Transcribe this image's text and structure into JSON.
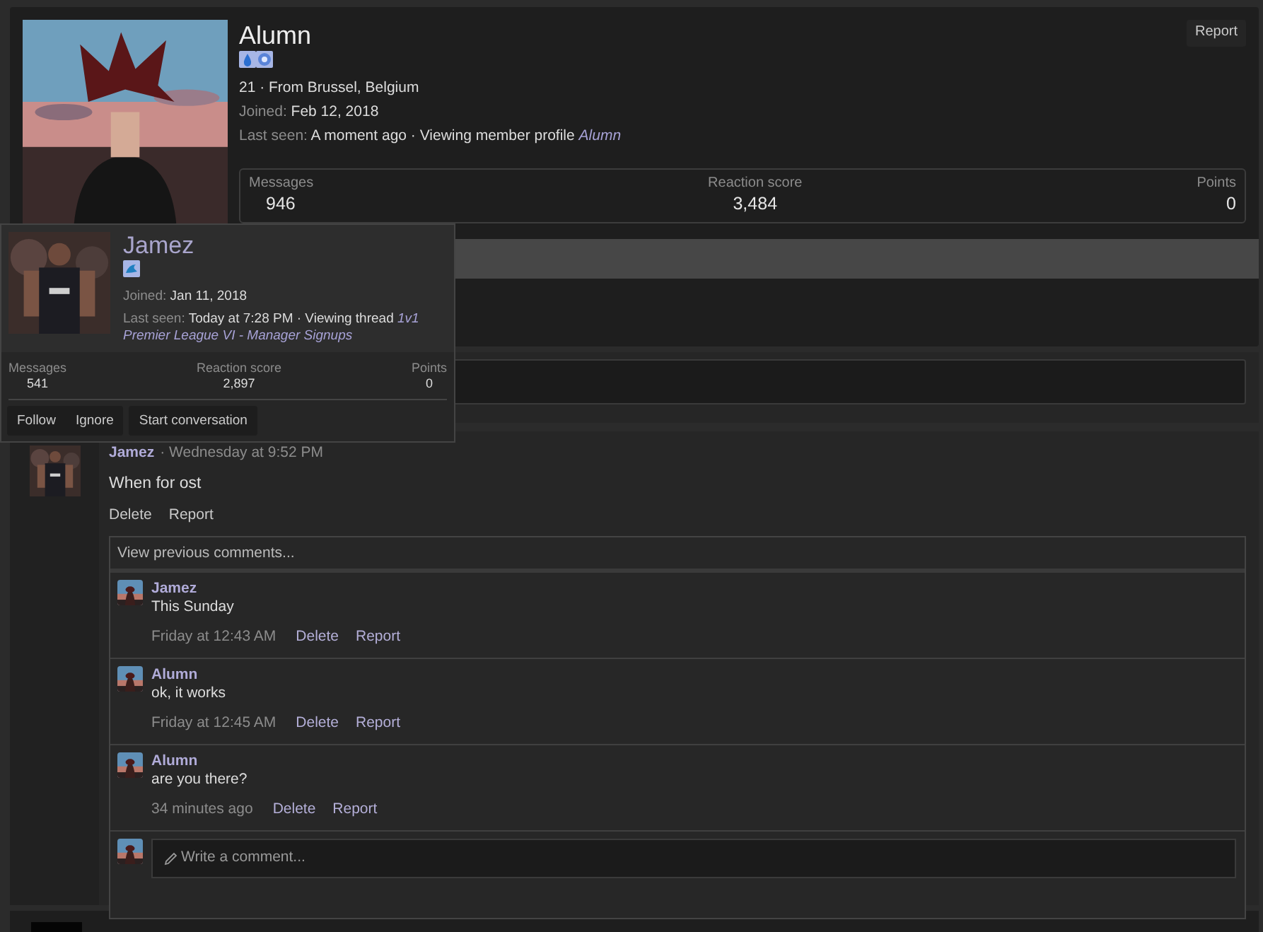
{
  "profile": {
    "name": "Alumn",
    "report": "Report",
    "about": "21 · From Brussel, Belgium",
    "joined": {
      "label": "Joined:",
      "value": "Feb 12, 2018"
    },
    "last_seen": {
      "label": "Last seen:",
      "value": "A moment ago · Viewing member profile",
      "link": "Alumn"
    },
    "stats": [
      {
        "label": "Messages",
        "value": "946"
      },
      {
        "label": "Reaction score",
        "value": "3,484"
      },
      {
        "label": "Points",
        "value": "0"
      }
    ]
  },
  "status_field": {
    "kind": "empty"
  },
  "popup": {
    "name": "Jamez",
    "joined": {
      "label": "Joined:",
      "value": "Jan 11, 2018"
    },
    "last_seen": {
      "label": "Last seen:",
      "value": "Today at 7:28 PM · Viewing thread",
      "link": "1v1 Premier League VI - Manager Signups"
    },
    "stats": [
      {
        "label": "Messages",
        "value": "541"
      },
      {
        "label": "Reaction score",
        "value": "2,897"
      },
      {
        "label": "Points",
        "value": "0"
      }
    ],
    "button_groups": [
      [
        "Follow",
        "Ignore"
      ],
      [
        "Start conversation"
      ]
    ]
  },
  "post": {
    "author": "Jamez",
    "time": "· Wednesday at 9:52 PM",
    "body": "When for ost",
    "actions": [
      "Delete",
      "Report"
    ],
    "view_previous": "View previous comments...",
    "comments": [
      {
        "author": "Jamez",
        "text": "This Sunday",
        "time": "Friday at 12:43 AM",
        "actions": [
          "Delete",
          "Report"
        ]
      },
      {
        "author": "Alumn",
        "text": "ok, it works",
        "time": "Friday at 12:45 AM",
        "actions": [
          "Delete",
          "Report"
        ]
      },
      {
        "author": "Alumn",
        "text": "are you there?",
        "time": "34 minutes ago",
        "actions": [
          "Delete",
          "Report"
        ]
      }
    ],
    "comment_field": {
      "placeholder": "Write a comment..."
    }
  }
}
